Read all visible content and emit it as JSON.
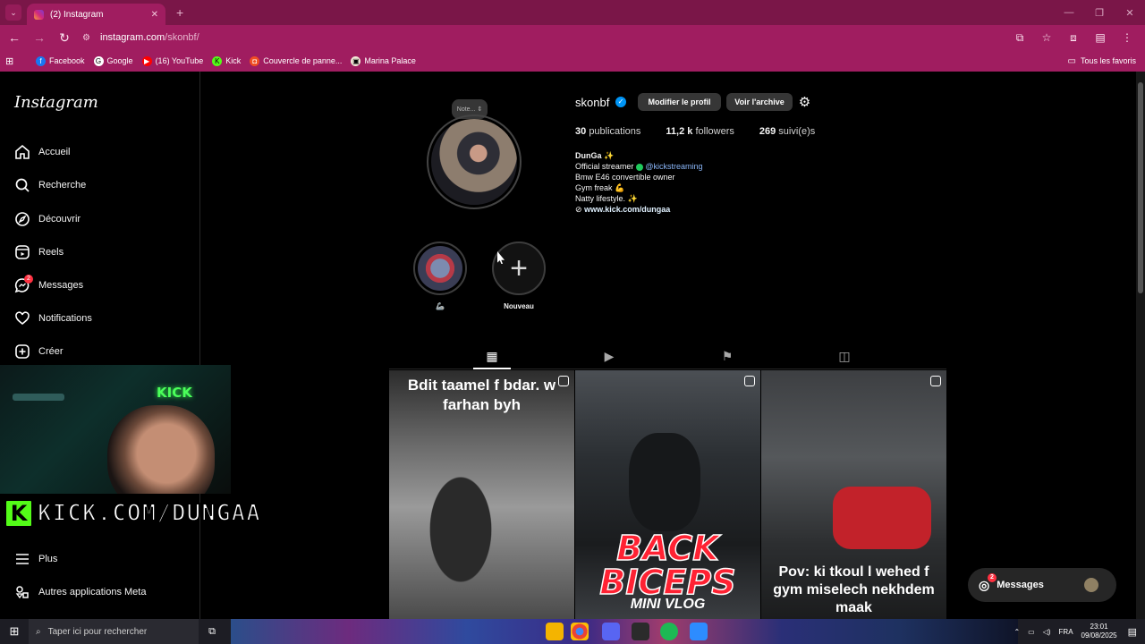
{
  "browser": {
    "tab_title": "(2) Instagram",
    "url_host": "instagram.com",
    "url_path": "/skonbf/",
    "bookmarks": [
      {
        "label": "Facebook",
        "color": "#1877f2",
        "glyph": "f"
      },
      {
        "label": "Google",
        "color": "#ffffff",
        "glyph": "G"
      },
      {
        "label": "(16) YouTube",
        "color": "#ff0000",
        "glyph": "▶"
      },
      {
        "label": "Kick",
        "color": "#53fc18",
        "glyph": "K"
      },
      {
        "label": "Couvercle de panne...",
        "color": "#f04f23",
        "glyph": "◘"
      },
      {
        "label": "Marina Palace",
        "color": "#f2e9d8",
        "glyph": "▣"
      }
    ],
    "all_bookmarks": "Tous les favoris"
  },
  "sidebar": {
    "logo": "Instagram",
    "items": [
      {
        "label": "Accueil",
        "icon": "home-icon"
      },
      {
        "label": "Recherche",
        "icon": "search-icon"
      },
      {
        "label": "Découvrir",
        "icon": "compass-icon"
      },
      {
        "label": "Reels",
        "icon": "reels-icon"
      },
      {
        "label": "Messages",
        "icon": "messenger-icon",
        "badge": "2"
      },
      {
        "label": "Notifications",
        "icon": "heart-icon"
      },
      {
        "label": "Créer",
        "icon": "plus-square-icon"
      }
    ],
    "more": "Plus",
    "meta": "Autres applications Meta"
  },
  "profile": {
    "note": "Note...",
    "username": "skonbf",
    "edit_button": "Modifier le profil",
    "archive_button": "Voir l'archive",
    "posts_count": "30",
    "posts_label": "publications",
    "followers_count": "11,2 k",
    "followers_label": "followers",
    "following_count": "269",
    "following_label": "suivi(e)s",
    "bio_name": "DunGa ✨",
    "bio_line1_prefix": "Official streamer",
    "bio_mention": "@kickstreaming",
    "bio_line2": "Bmw E46 convertible owner",
    "bio_line3": "Gym freak 💪",
    "bio_line4": "Natty lifestyle. ✨",
    "bio_link": "www.kick.com/dungaa"
  },
  "highlights": [
    {
      "label": "🦾"
    },
    {
      "label": "Nouveau"
    }
  ],
  "posts": [
    {
      "overlay_top": "Bdit taamel f bdar. w farhan byh",
      "overlay_bottom": ""
    },
    {
      "overlay_top": "",
      "overlay_bottom": "BACK BICEPS",
      "overlay_sub": "MINI VLOG"
    },
    {
      "overlay_top": "",
      "overlay_bottom": "Pov: ki tkoul l wehed f gym miselech nekhdem maak"
    }
  ],
  "stream": {
    "banner": "KICK.COM/DUNGAA",
    "glow": "KICK"
  },
  "messages_pill": {
    "label": "Messages",
    "badge": "2"
  },
  "taskbar": {
    "search_placeholder": "Taper ici pour rechercher",
    "lang": "FRA",
    "time": "23:01",
    "date": "09/08/2025"
  }
}
